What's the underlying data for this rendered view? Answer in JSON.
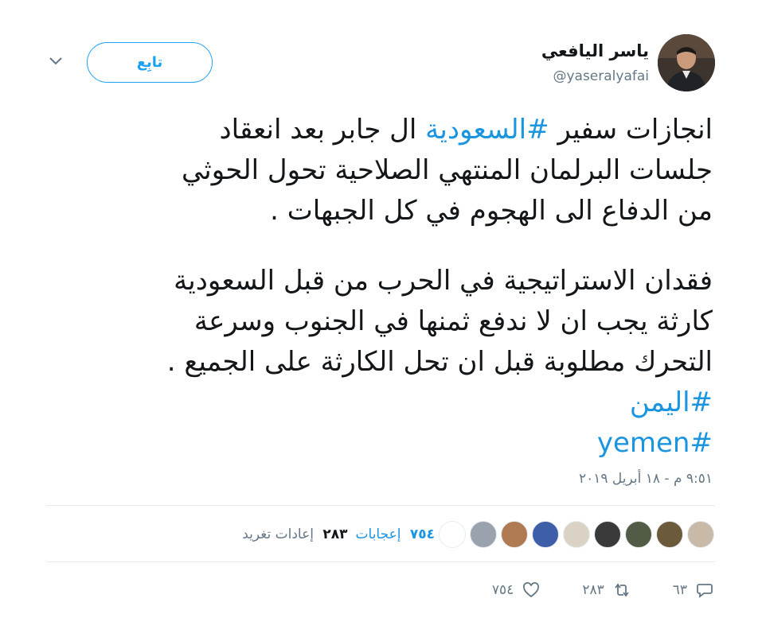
{
  "author": {
    "display_name": "ياسر اليافعي",
    "handle": "@yaseralyafai"
  },
  "follow_button": "تابِع",
  "menu_icon": "chevron-down-icon",
  "tweet": {
    "para1_line1_a": "انجازات سفير ",
    "para1_hashtag": "#السعودية",
    "para1_line1_b": " ال جابر بعد انعقاد",
    "para1_line2": "جلسات البرلمان المنتهي الصلاحية تحول الحوثي",
    "para1_line3": "من الدفاع الى الهجوم في كل الجبهات .",
    "para2_line1": "فقدان الاستراتيجية في الحرب من قبل السعودية",
    "para2_line2": "كارثة يجب ان لا ندفع ثمنها في الجنوب وسرعة",
    "para2_line3": "التحرك مطلوبة قبل ان تحل الكارثة على الجميع .",
    "hashtag_yemen_ar": "#اليمن",
    "hashtag_yemen_en": "#yemen"
  },
  "timestamp": "٩:٥١ م - ١٨ أبريل ٢٠١٩",
  "stats": {
    "retweets_count": "٢٨٣",
    "retweets_label": "إعادات تغريد",
    "likes_count": "٧٥٤",
    "likes_label": "إعجابات"
  },
  "liker_avatar_colors": [
    "#ffffff",
    "#9aa3ad",
    "#b07a52",
    "#3e5fa8",
    "#d9d2c5",
    "#3a3a3a",
    "#515b46",
    "#6b5a3c",
    "#c9b9a9"
  ],
  "actions": {
    "reply_count": "٦٣",
    "retweet_count": "٢٨٣",
    "like_count": "٧٥٤"
  },
  "colors": {
    "accent": "#1da1f2",
    "link": "#1b95e0",
    "muted": "#657786",
    "divider": "#e6ecf0"
  }
}
